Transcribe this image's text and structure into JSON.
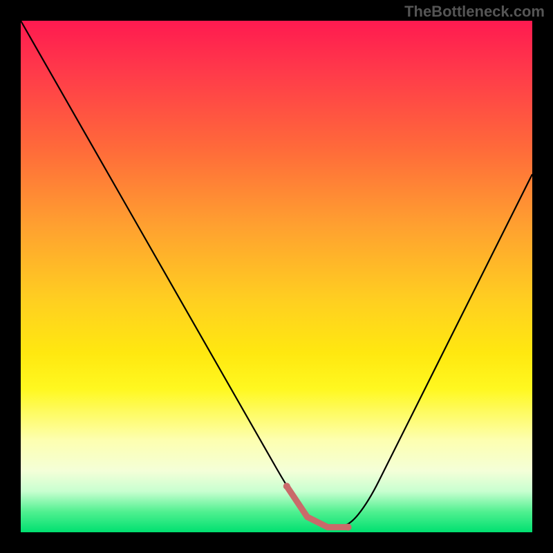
{
  "watermark": "TheBottleneck.com",
  "chart_data": {
    "type": "line",
    "title": "",
    "xlabel": "",
    "ylabel": "",
    "xlim": [
      0,
      100
    ],
    "ylim": [
      0,
      100
    ],
    "series": [
      {
        "name": "bottleneck-curve",
        "x": [
          0,
          8,
          16,
          24,
          32,
          40,
          48,
          52,
          56,
          60,
          64,
          68,
          72,
          80,
          88,
          96,
          100
        ],
        "values": [
          100,
          86,
          72,
          58,
          44,
          30,
          16,
          9,
          3,
          1,
          1,
          6,
          14,
          30,
          46,
          62,
          70
        ]
      }
    ],
    "marker_region": {
      "x_start": 52,
      "x_end": 66,
      "color": "#c96a6a"
    },
    "background_gradient": {
      "top_color": "#ff1a50",
      "mid_color": "#ffd020",
      "bottom_color": "#00e070"
    }
  }
}
